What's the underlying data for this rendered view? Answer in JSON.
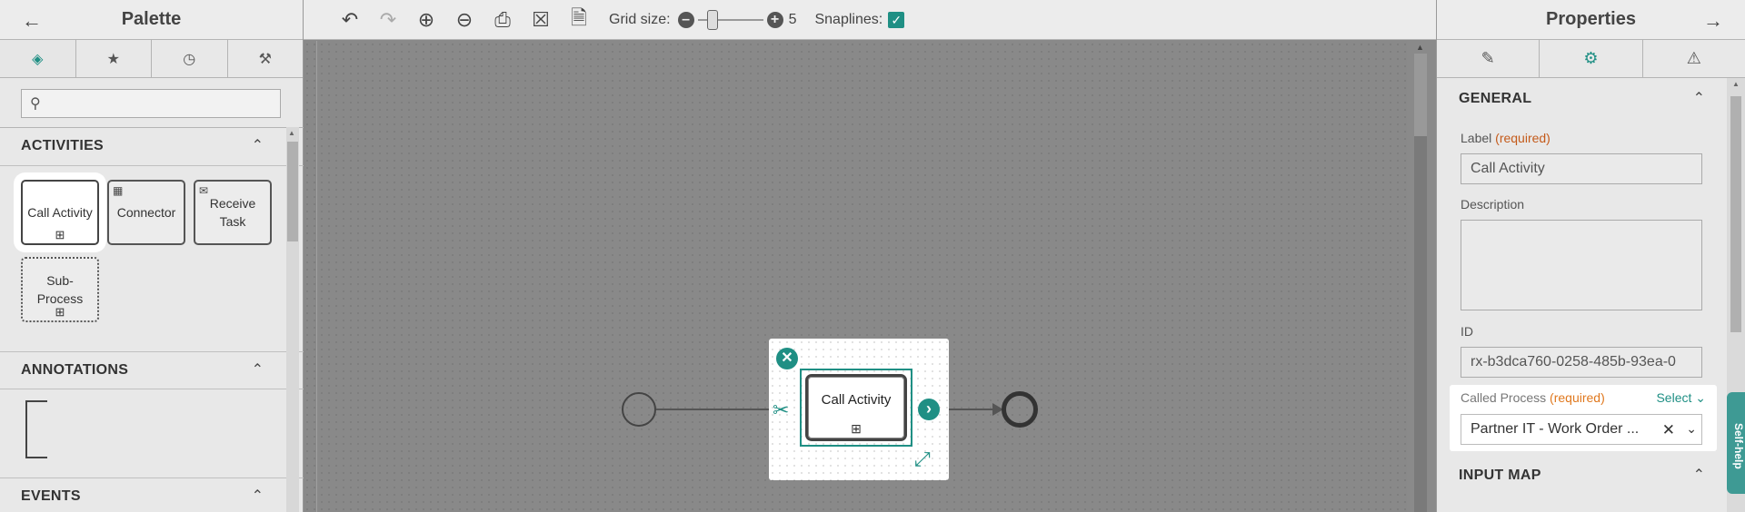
{
  "palette": {
    "title": "Palette",
    "back_icon": "arrow-left-icon",
    "tabs": [
      {
        "icon": "shapes-icon",
        "active": true
      },
      {
        "icon": "star-icon",
        "active": false
      },
      {
        "icon": "clock-icon",
        "active": false
      },
      {
        "icon": "wrench-icon",
        "active": false
      }
    ],
    "search_placeholder": "",
    "sections": {
      "activities": {
        "title": "ACTIVITIES",
        "items": [
          {
            "label": "Call Activity"
          },
          {
            "label": "Connector"
          },
          {
            "label": "Receive Task"
          },
          {
            "label": "Sub-Process"
          }
        ]
      },
      "annotations": {
        "title": "ANNOTATIONS"
      },
      "events": {
        "title": "EVENTS"
      }
    }
  },
  "toolbar": {
    "grid_size_label": "Grid size:",
    "grid_size_value": "5",
    "snaplines_label": "Snaplines:",
    "snaplines_checked": true
  },
  "canvas": {
    "selected_task_label": "Call Activity"
  },
  "properties": {
    "title": "Properties",
    "forward_icon": "arrow-right-icon",
    "tabs": [
      {
        "icon": "pencil-icon",
        "active": false
      },
      {
        "icon": "gear-icon",
        "active": true
      },
      {
        "icon": "warning-icon",
        "active": false
      }
    ],
    "general_title": "GENERAL",
    "label_label": "Label",
    "required_text": "(required)",
    "label_value": "Call Activity",
    "description_label": "Description",
    "id_label": "ID",
    "id_value": "rx-b3dca760-0258-485b-93ea-0",
    "called_process_label": "Called Process",
    "select_link": "Select",
    "called_process_value": "Partner IT - Work Order ...",
    "input_map_title": "INPUT MAP",
    "self_help": "Self-help"
  },
  "colors": {
    "accent": "#1f8f84",
    "required": "#c45a1a"
  }
}
